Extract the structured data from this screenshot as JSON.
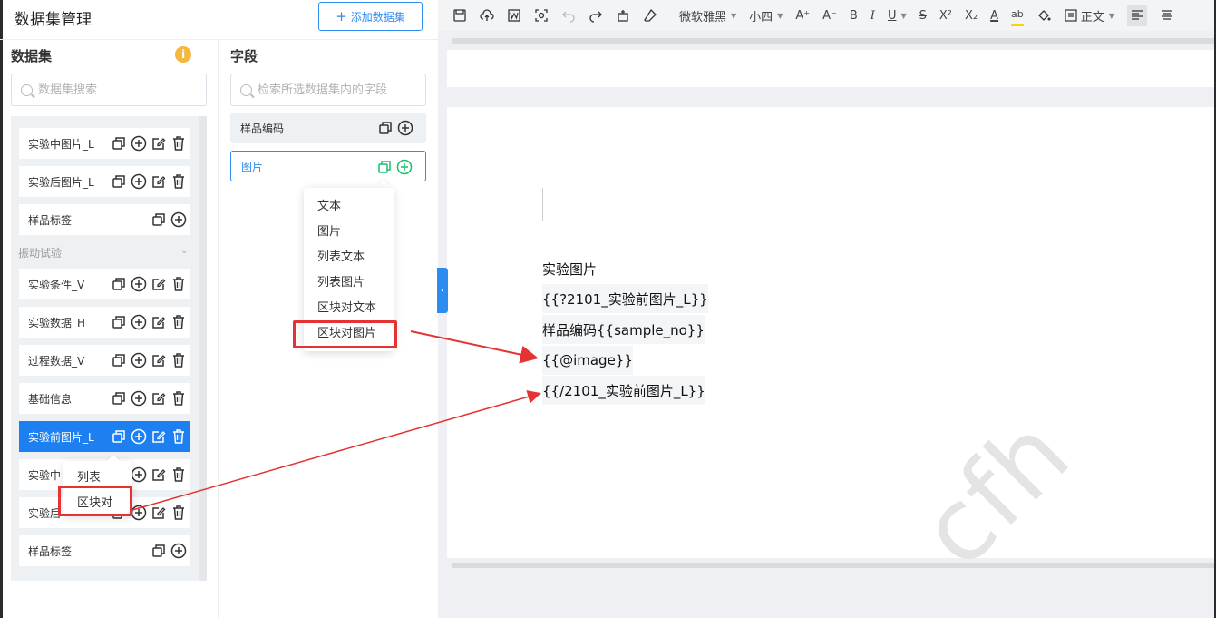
{
  "header": {
    "title": "数据集管理",
    "add_button": "添加数据集",
    "add_icon": "+"
  },
  "datasets": {
    "title": "数据集",
    "info_icon": "i",
    "search_placeholder": "数据集搜索",
    "items": [
      {
        "label": "实验中图片_L"
      },
      {
        "label": "实验后图片_L"
      },
      {
        "label": "样品标签"
      },
      {
        "label": "实验条件_V"
      },
      {
        "label": "实验数据_H"
      },
      {
        "label": "过程数据_V"
      },
      {
        "label": "基础信息"
      },
      {
        "label": "实验前图片_L"
      },
      {
        "label": "实验中"
      },
      {
        "label": "实验后"
      },
      {
        "label": "样品标签"
      }
    ],
    "group_title": "振动试验",
    "group_caret": "⌄",
    "context_menu": [
      "列表",
      "区块对"
    ]
  },
  "fields": {
    "title": "字段",
    "search_placeholder": "检索所选数据集内的字段",
    "items": [
      {
        "label": "样品编码"
      },
      {
        "label": "图片"
      }
    ],
    "type_menu": [
      "文本",
      "图片",
      "列表文本",
      "列表图片",
      "区块对文本",
      "区块对图片"
    ]
  },
  "collapse_icon": "‹",
  "toolbar": {
    "font_family": "微软雅黑",
    "font_size": "小四",
    "grow_font": "A⁺",
    "shrink_font": "A⁻",
    "bold": "B",
    "italic": "I",
    "underline": "U",
    "strike": "S",
    "superscript": "X²",
    "subscript": "X₂",
    "font_color": "A",
    "highlight": "ab",
    "paragraph_style": "正文"
  },
  "document": {
    "lines": [
      "实验图片",
      "{{?2101_实验前图片_L}}",
      "样品编码{{sample_no}}",
      "{{@image}}",
      "{{/2101_实验前图片_L}}"
    ],
    "watermark": "cfh"
  },
  "colors": {
    "primary": "#2d8cf0",
    "active_item": "#1e7ff0",
    "annotation_red": "#e53232",
    "field_add_green": "#19be6b"
  }
}
